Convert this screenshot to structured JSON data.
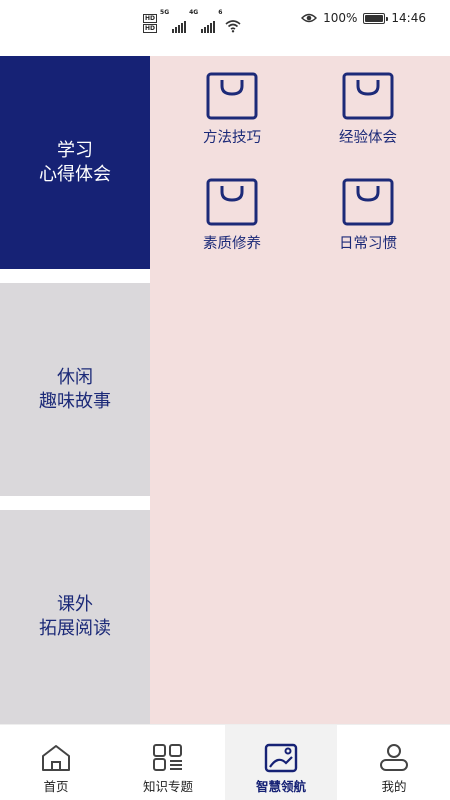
{
  "status_bar": {
    "hd1": "HD",
    "hd2": "HD",
    "net1": "5G",
    "net2": "4G",
    "wifi_sub": "6",
    "battery_percent": "100%",
    "time": "14:46",
    "icons": [
      "hd-icon",
      "signal-icon",
      "wifi-icon",
      "eye-icon",
      "battery-icon"
    ]
  },
  "sidebar": {
    "items": [
      {
        "line1": "学习",
        "line2": "心得体会",
        "active": true
      },
      {
        "line1": "休闲",
        "line2": "趣味故事",
        "active": false
      },
      {
        "line1": "课外",
        "line2": "拓展阅读",
        "active": false
      }
    ]
  },
  "content": {
    "items": [
      {
        "label": "方法技巧",
        "icon": "shopping-bag-icon"
      },
      {
        "label": "经验体会",
        "icon": "shopping-bag-icon"
      },
      {
        "label": "素质修养",
        "icon": "shopping-bag-icon"
      },
      {
        "label": "日常习惯",
        "icon": "shopping-bag-icon"
      }
    ]
  },
  "bottom_nav": {
    "items": [
      {
        "label": "首页",
        "icon": "home-icon",
        "active": false
      },
      {
        "label": "知识专题",
        "icon": "grid-list-icon",
        "active": false
      },
      {
        "label": "智慧领航",
        "icon": "image-frame-icon",
        "active": true
      },
      {
        "label": "我的",
        "icon": "user-icon",
        "active": false
      }
    ]
  },
  "colors": {
    "primary_navy": "#162275",
    "sidebar_inactive": "#dad8db",
    "content_bg": "#f3dfde",
    "text_navy": "#1c2a78"
  }
}
